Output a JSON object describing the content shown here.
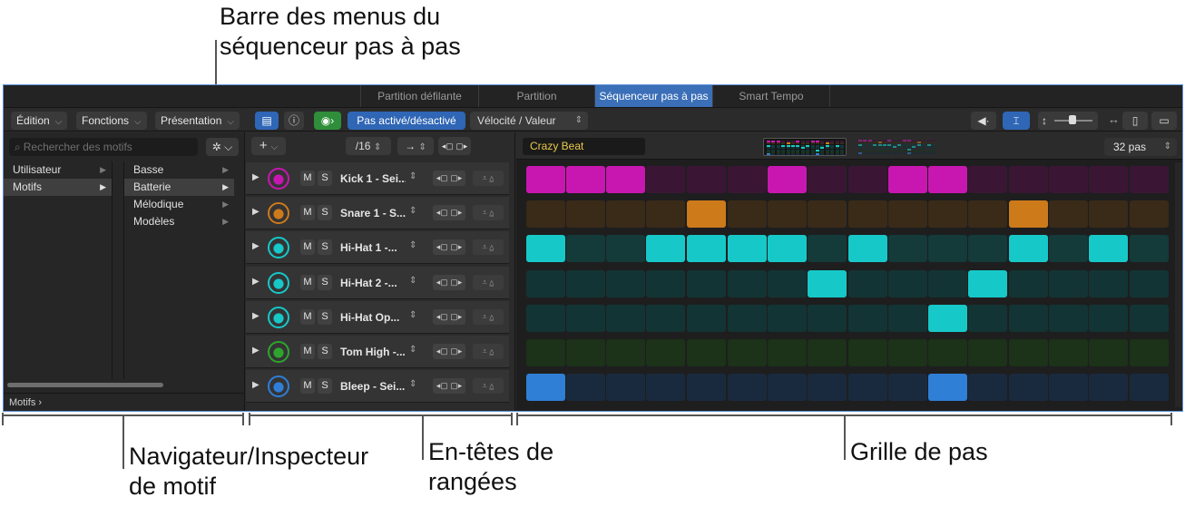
{
  "annotations": {
    "menubar": "Barre des menus du\nséquenceur pas à pas",
    "navigator": "Navigateur/Inspecteur\nde motif",
    "row_headers": "En-têtes de\nrangées",
    "step_grid": "Grille de pas"
  },
  "tabs": [
    {
      "label": "Partition défilante",
      "active": false
    },
    {
      "label": "Partition",
      "active": false
    },
    {
      "label": "Séquenceur pas à pas",
      "active": true
    },
    {
      "label": "Smart Tempo",
      "active": false
    }
  ],
  "menubar": {
    "edit": "Édition",
    "functions": "Fonctions",
    "view": "Présentation",
    "step_on_off": "Pas activé/désactivé",
    "velocity": "Vélocité / Valeur"
  },
  "navigator": {
    "search_placeholder": "Rechercher des motifs",
    "col1": [
      {
        "label": "Utilisateur",
        "selected": false
      },
      {
        "label": "Motifs",
        "selected": true
      }
    ],
    "col2": [
      {
        "label": "Basse",
        "selected": false
      },
      {
        "label": "Batterie",
        "selected": true
      },
      {
        "label": "Mélodique",
        "selected": false
      },
      {
        "label": "Modèles",
        "selected": false
      }
    ],
    "footer": "Motifs ›"
  },
  "row_header_toolbar": {
    "add": "+",
    "resolution": "/16"
  },
  "pattern": {
    "name": "Crazy Beat",
    "steps_label": "32 pas"
  },
  "rows": [
    {
      "name": "Kick 1 - Sei...",
      "mute": "M",
      "solo": "S",
      "icon": "kick-drum-icon",
      "color": "#c817b0",
      "dim": "#3a1634",
      "steps": [
        1,
        1,
        1,
        0,
        0,
        0,
        1,
        0,
        0,
        1,
        1,
        0,
        0,
        0,
        0,
        0
      ]
    },
    {
      "name": "Snare 1 - S...",
      "mute": "M",
      "solo": "S",
      "icon": "snare-drum-icon",
      "color": "#cc7a1a",
      "dim": "#3a2a18",
      "steps": [
        0,
        0,
        0,
        0,
        1,
        0,
        0,
        0,
        0,
        0,
        0,
        0,
        1,
        0,
        0,
        0
      ]
    },
    {
      "name": "Hi-Hat 1 -...",
      "mute": "M",
      "solo": "S",
      "icon": "hi-hat-icon",
      "color": "#17c8c8",
      "dim": "#143a3a",
      "steps": [
        1,
        0,
        0,
        1,
        1,
        1,
        1,
        0,
        1,
        0,
        0,
        0,
        1,
        0,
        1,
        0
      ]
    },
    {
      "name": "Hi-Hat 2 -...",
      "mute": "M",
      "solo": "S",
      "icon": "hi-hat-open-icon",
      "color": "#17c8c8",
      "dim": "#133434",
      "steps": [
        0,
        0,
        0,
        0,
        0,
        0,
        0,
        1,
        0,
        0,
        0,
        1,
        0,
        0,
        0,
        0
      ]
    },
    {
      "name": "Hi-Hat Op...",
      "mute": "M",
      "solo": "S",
      "icon": "hi-hat-icon",
      "color": "#17c8c8",
      "dim": "#133434",
      "steps": [
        0,
        0,
        0,
        0,
        0,
        0,
        0,
        0,
        0,
        0,
        1,
        0,
        0,
        0,
        0,
        0
      ]
    },
    {
      "name": "Tom High -...",
      "mute": "M",
      "solo": "S",
      "icon": "tom-drum-icon",
      "color": "#2da52d",
      "dim": "#1c3219",
      "steps": [
        0,
        0,
        0,
        0,
        0,
        0,
        0,
        0,
        0,
        0,
        0,
        0,
        0,
        0,
        0,
        0
      ]
    },
    {
      "name": "Bleep - Sei...",
      "mute": "M",
      "solo": "S",
      "icon": "bleep-drum-icon",
      "color": "#2f7fd6",
      "dim": "#1a2a3e",
      "steps": [
        1,
        0,
        0,
        0,
        0,
        0,
        0,
        0,
        0,
        0,
        1,
        0,
        0,
        0,
        0,
        0
      ]
    }
  ]
}
